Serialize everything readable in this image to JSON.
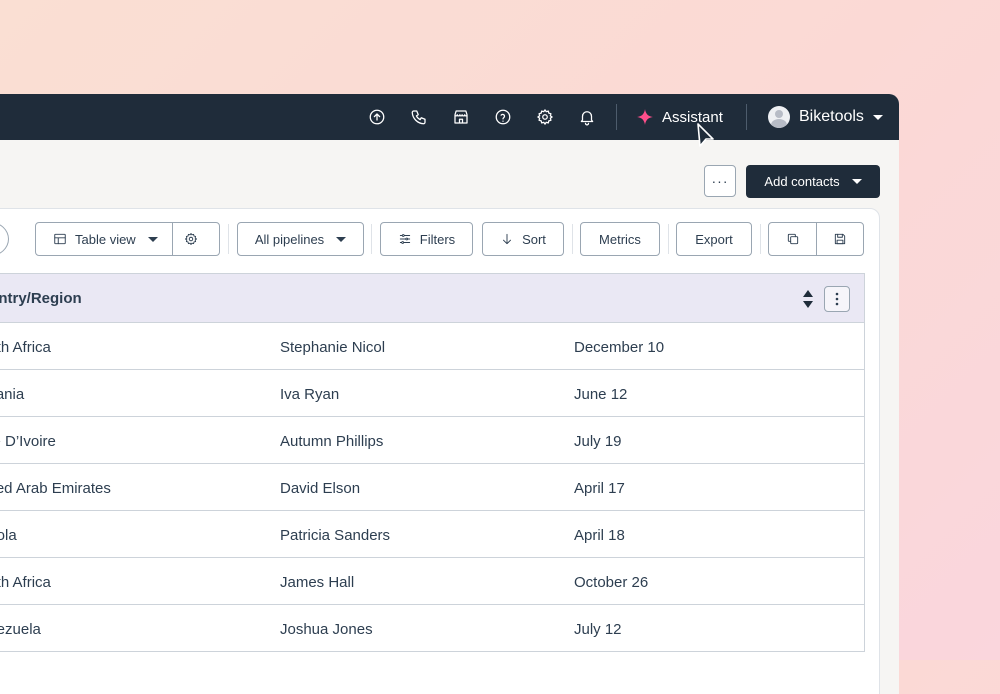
{
  "topnav": {
    "icons": [
      "upgrade-icon",
      "phone-icon",
      "marketplace-icon",
      "help-icon",
      "gear-icon",
      "bell-icon"
    ],
    "assistant_label": "Assistant",
    "account_label": "Biketools"
  },
  "header_actions": {
    "more_label": "···",
    "add_contacts_label": "Add contacts"
  },
  "toolbar": {
    "table_view_label": "Table view",
    "all_pipelines_label": "All pipelines",
    "filters_label": "Filters",
    "sort_label": "Sort",
    "metrics_label": "Metrics",
    "export_label": "Export"
  },
  "table": {
    "column_header": "ountry/Region",
    "rows": [
      [
        "outh Africa",
        "Stephanie Nicol",
        "December 10"
      ],
      [
        "nzania",
        "Iva Ryan",
        "June 12"
      ],
      [
        "ote D’Ivoire",
        "Autumn Phillips",
        "July 19"
      ],
      [
        "nited Arab Emirates",
        "David Elson",
        "April 17"
      ],
      [
        "ngola",
        "Patricia Sanders",
        "April 18"
      ],
      [
        "outh Africa",
        "James Hall",
        "October 26"
      ],
      [
        "enezuela",
        "Joshua Jones",
        "July 12"
      ]
    ]
  },
  "colors": {
    "nav_bg": "#1f2c3a",
    "assistant_accent": "#ff4f8b",
    "header_bg": "#eae8f4"
  }
}
